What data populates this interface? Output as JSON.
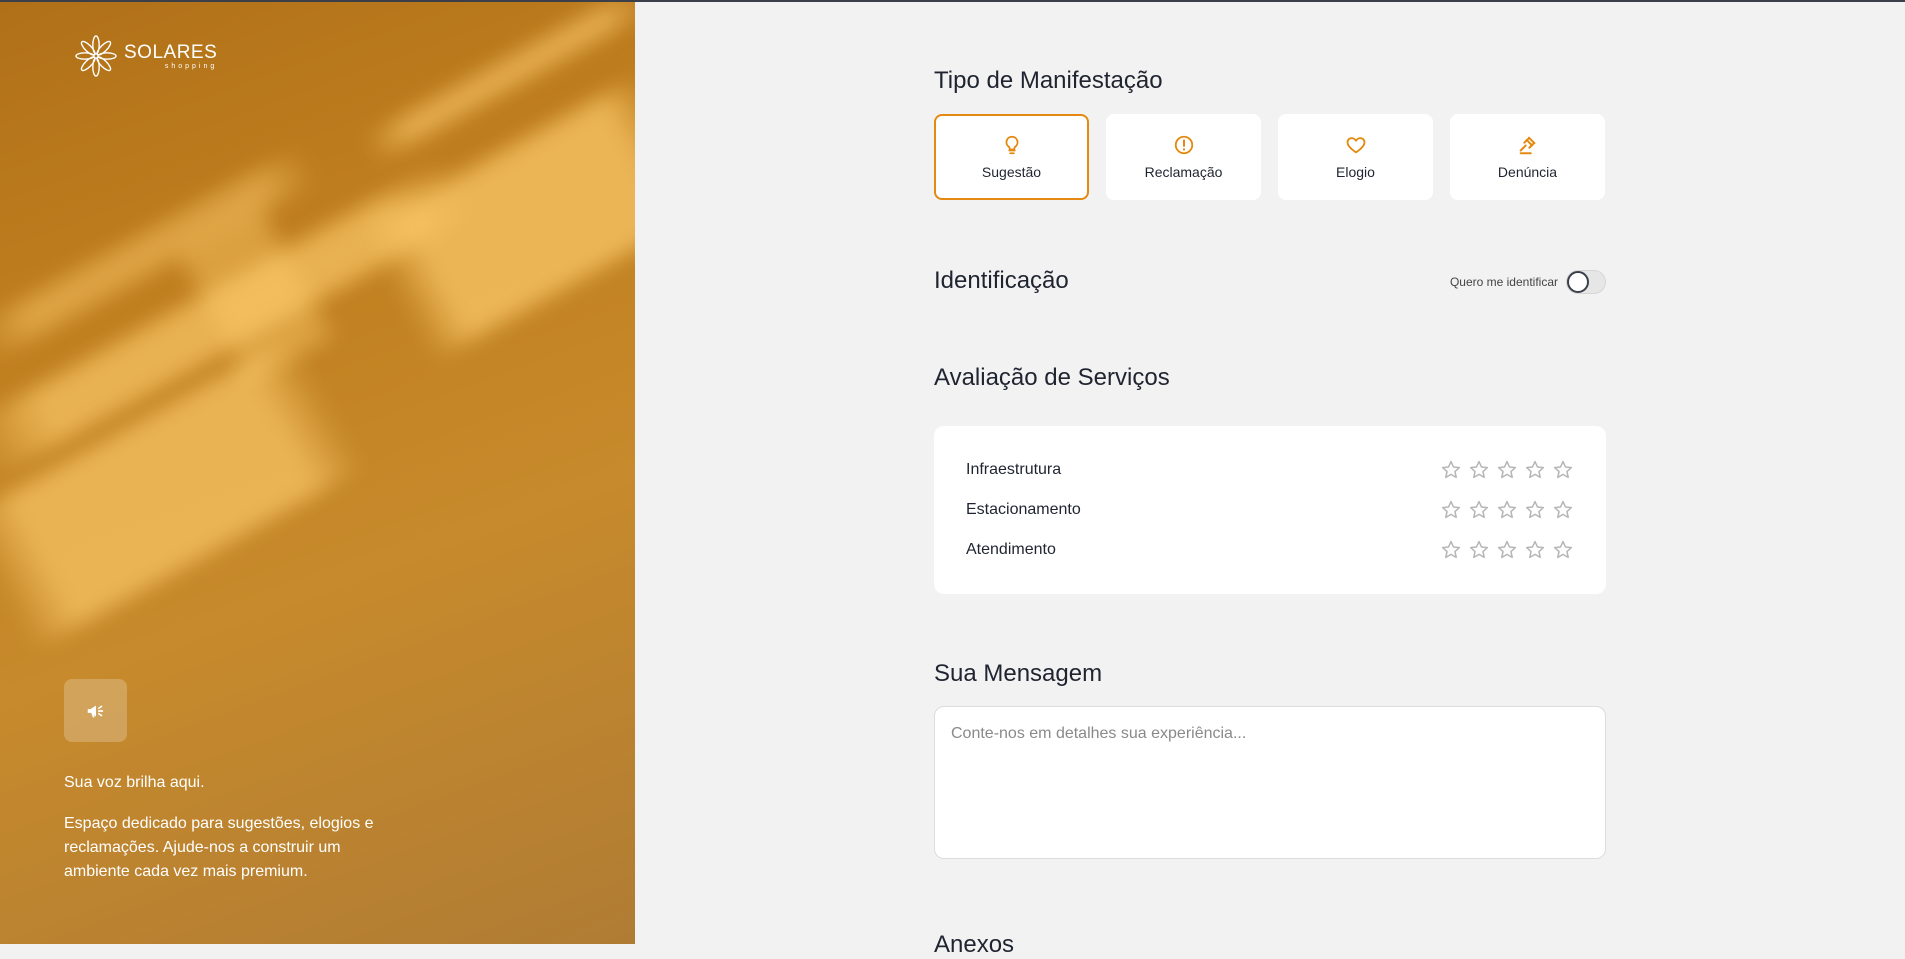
{
  "brand": {
    "name": "SOLARES",
    "sub": "shopping"
  },
  "hero": {
    "icon": "megaphone-icon",
    "title": "Sua voz brilha aqui.",
    "description": "Espaço dedicado para sugestões, elogios e reclamações. Ajude-nos a construir um ambiente cada vez mais premium."
  },
  "form": {
    "type_section": {
      "title": "Tipo de Manifestação",
      "options": [
        {
          "label": "Sugestão",
          "icon": "lightbulb-icon",
          "selected": true
        },
        {
          "label": "Reclamação",
          "icon": "alert-circle-icon",
          "selected": false
        },
        {
          "label": "Elogio",
          "icon": "heart-icon",
          "selected": false
        },
        {
          "label": "Denúncia",
          "icon": "gavel-icon",
          "selected": false
        }
      ]
    },
    "identification": {
      "title": "Identificação",
      "toggle_label": "Quero me identificar",
      "toggle_on": false
    },
    "ratings": {
      "title": "Avaliação de Serviços",
      "max_stars": 5,
      "items": [
        {
          "label": "Infraestrutura",
          "value": 0
        },
        {
          "label": "Estacionamento",
          "value": 0
        },
        {
          "label": "Atendimento",
          "value": 0
        }
      ]
    },
    "message": {
      "title": "Sua Mensagem",
      "placeholder": "Conte-nos em detalhes sua experiência...",
      "value": ""
    },
    "attachments": {
      "title": "Anexos"
    }
  },
  "colors": {
    "accent": "#e48a10",
    "panel": "#c07f1f",
    "star_empty": "#b5b5b5"
  }
}
